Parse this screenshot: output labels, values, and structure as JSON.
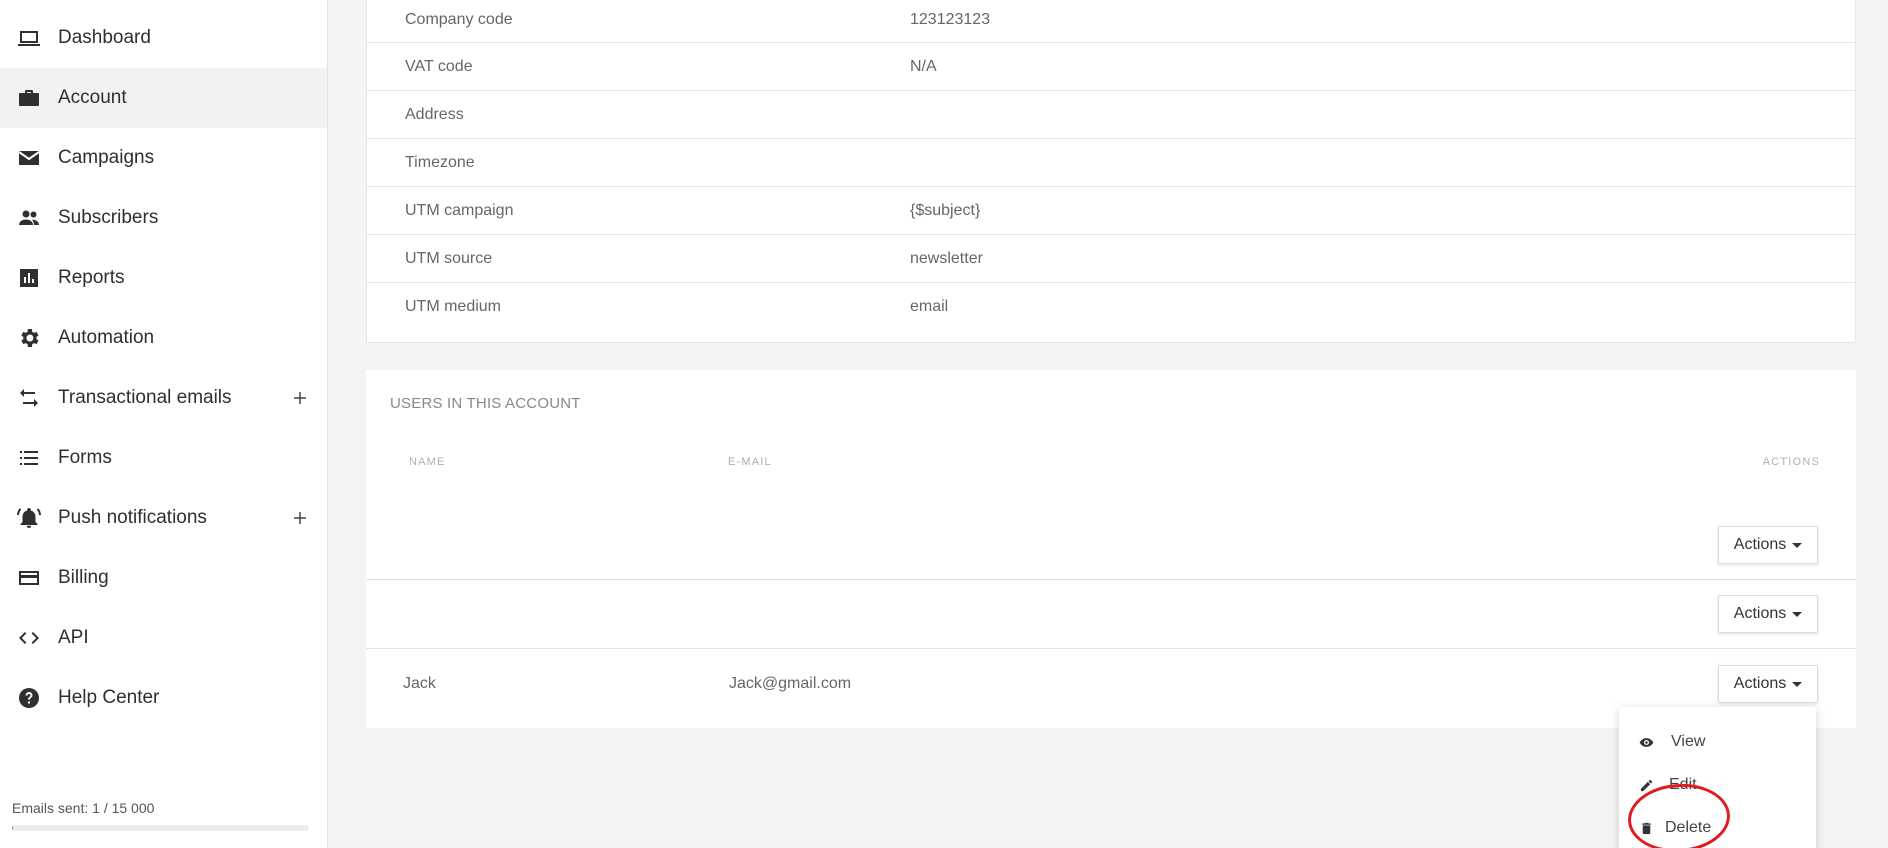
{
  "sidebar": {
    "items": [
      {
        "label": "Dashboard",
        "icon": "laptop-icon"
      },
      {
        "label": "Account",
        "icon": "briefcase-icon",
        "active": true
      },
      {
        "label": "Campaigns",
        "icon": "mail-icon"
      },
      {
        "label": "Subscribers",
        "icon": "people-icon"
      },
      {
        "label": "Reports",
        "icon": "bar-chart-icon"
      },
      {
        "label": "Automation",
        "icon": "gear-icon"
      },
      {
        "label": "Transactional emails",
        "icon": "swap-arrows-icon",
        "plus": true
      },
      {
        "label": "Forms",
        "icon": "list-icon"
      },
      {
        "label": "Push notifications",
        "icon": "bell-ring-icon",
        "plus": true
      },
      {
        "label": "Billing",
        "icon": "credit-card-icon"
      },
      {
        "label": "API",
        "icon": "code-icon"
      },
      {
        "label": "Help Center",
        "icon": "help-circle-icon"
      }
    ],
    "emails_sent": "Emails sent: 1 / 15 000",
    "emails_progress": 0.0001
  },
  "details": {
    "rows": [
      {
        "label": "Company code",
        "value": "123123123"
      },
      {
        "label": "VAT code",
        "value": "N/A"
      },
      {
        "label": "Address",
        "value": ""
      },
      {
        "label": "Timezone",
        "value": ""
      },
      {
        "label": "UTM campaign",
        "value": "{$subject}"
      },
      {
        "label": "UTM source",
        "value": "newsletter"
      },
      {
        "label": "UTM medium",
        "value": "email"
      }
    ]
  },
  "users": {
    "title": "USERS IN THIS ACCOUNT",
    "columns": {
      "name": "NAME",
      "email": "E-MAIL",
      "actions": "ACTIONS"
    },
    "rows": [
      {
        "name": "",
        "email": "",
        "actions_label": "Actions"
      },
      {
        "name": "",
        "email": "",
        "actions_label": "Actions"
      },
      {
        "name": "Jack",
        "email": "Jack@gmail.com",
        "actions_label": "Actions"
      }
    ]
  },
  "dropdown": {
    "items": [
      {
        "label": "View",
        "icon": "eye-icon"
      },
      {
        "label": "Edit",
        "icon": "pencil-icon"
      },
      {
        "label": "Delete",
        "icon": "trash-icon"
      }
    ]
  },
  "colors": {
    "annotation": "#e11b22",
    "background": "#f3f4f3"
  }
}
